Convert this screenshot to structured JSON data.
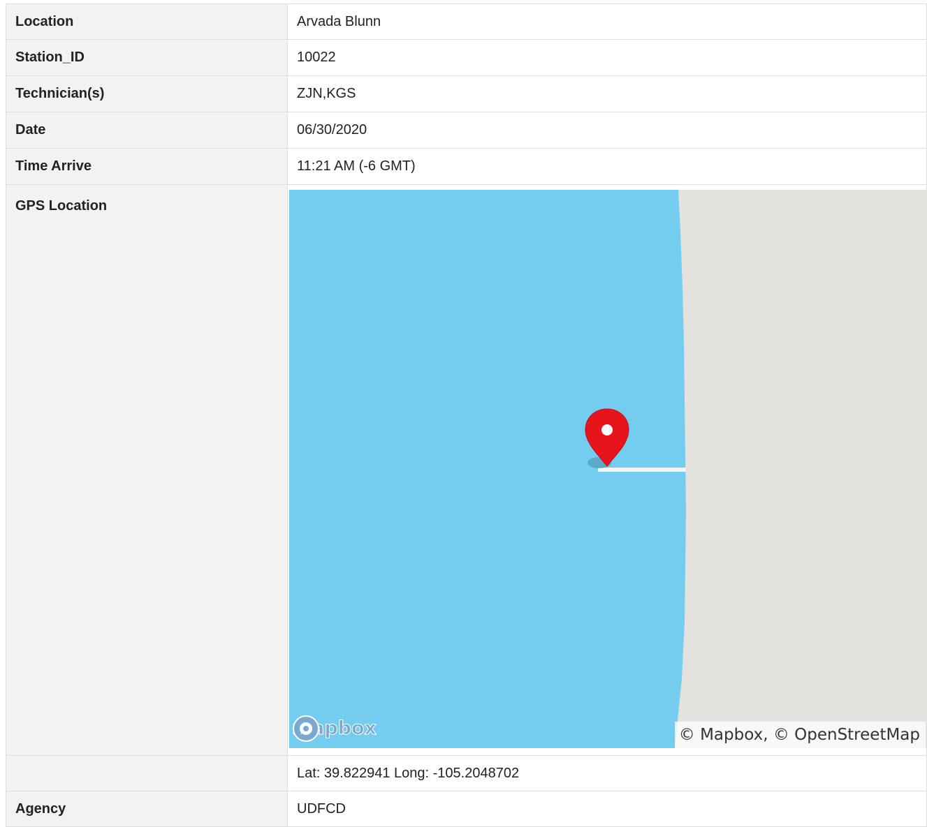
{
  "rows": {
    "location": {
      "label": "Location",
      "value": "Arvada Blunn"
    },
    "station_id": {
      "label": "Station_ID",
      "value": "10022"
    },
    "technicians": {
      "label": "Technician(s)",
      "value": "ZJN,KGS"
    },
    "date": {
      "label": "Date",
      "value": "06/30/2020"
    },
    "time_arrive": {
      "label": "Time Arrive",
      "value": "11:21 AM (-6 GMT)"
    },
    "gps": {
      "label": "GPS Location"
    },
    "coords": {
      "label": "",
      "value": "Lat: 39.822941 Long: -105.2048702"
    },
    "agency": {
      "label": "Agency",
      "value": "UDFCD"
    }
  },
  "map": {
    "logo_text": "mapbox",
    "attribution": "© Mapbox, © OpenStreetMap",
    "marker_icon": "map-pin-icon",
    "colors": {
      "water": "#74cdef",
      "land": "#e4e2de",
      "marker": "#e8141c",
      "road": "#f4f4f2"
    }
  }
}
